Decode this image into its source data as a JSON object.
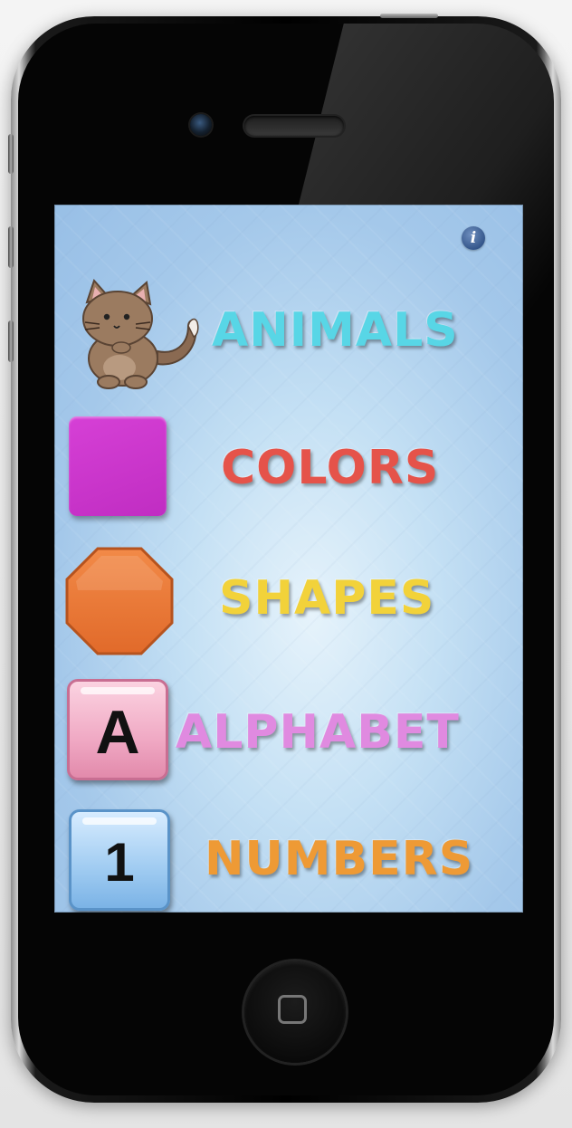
{
  "screen": {
    "info_label": "i"
  },
  "menu": [
    {
      "label": "ANIMALS",
      "color": "#58d6e6",
      "icon": "cat-icon"
    },
    {
      "label": "COLORS",
      "color": "#e5534a",
      "icon": "purple-square-icon"
    },
    {
      "label": "SHAPES",
      "color": "#f2d23a",
      "icon": "orange-octagon-icon"
    },
    {
      "label": "ALPHABET",
      "color": "#e08ae0",
      "icon": "letter-tile-icon",
      "tile_text": "A"
    },
    {
      "label": "NUMBERS",
      "color": "#ee9a35",
      "icon": "number-tile-icon",
      "tile_text": "1"
    }
  ],
  "colors": {
    "screen_bg": "#a4c8ea",
    "color_square": "#c83ac9",
    "octagon": "#ee7a3a"
  }
}
